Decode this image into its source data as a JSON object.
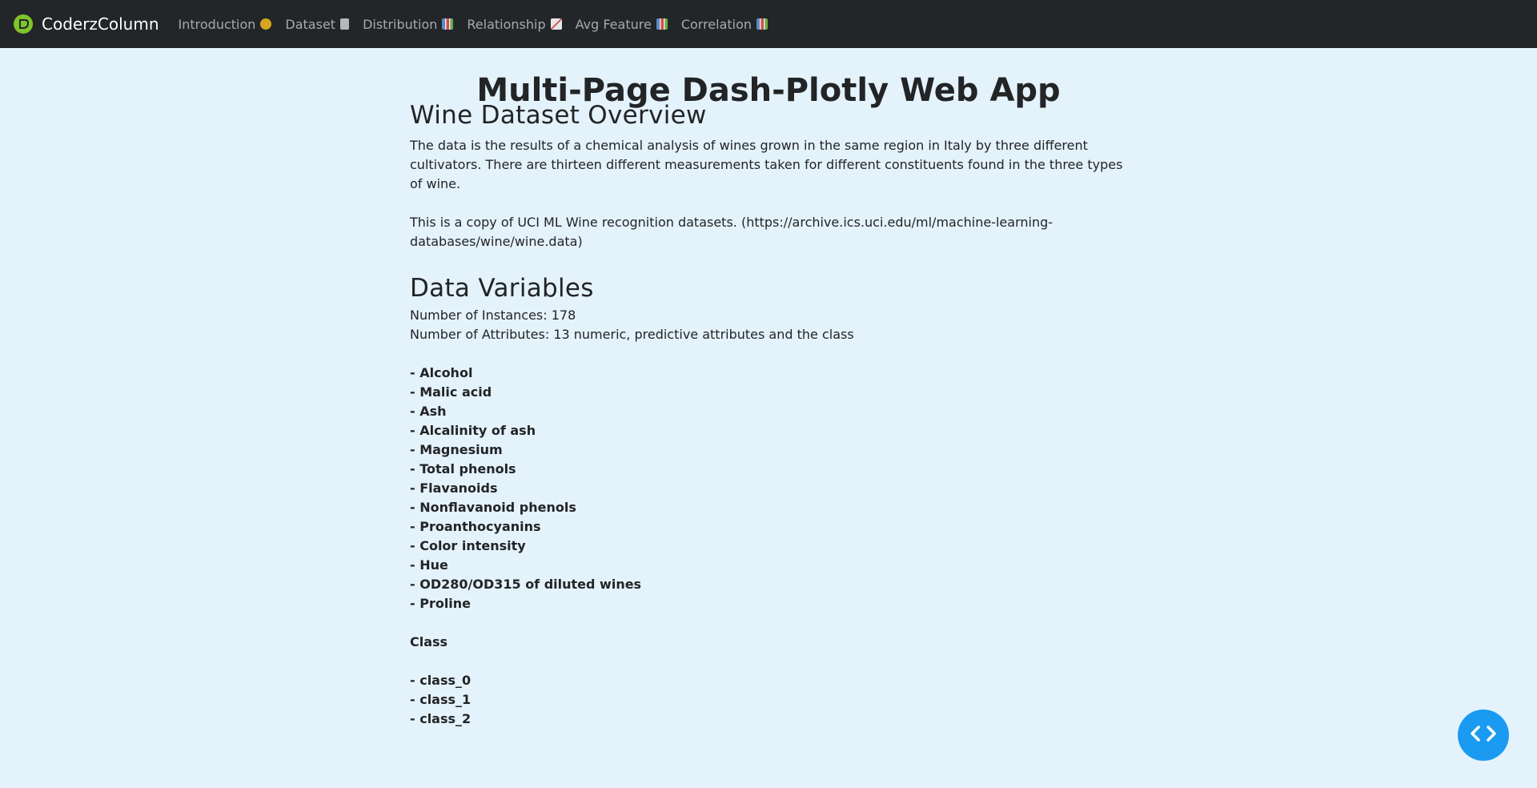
{
  "navbar": {
    "brand": "CoderzColumn",
    "links": [
      {
        "label": "Introduction",
        "icon": "smiley-emoji-icon"
      },
      {
        "label": "Dataset",
        "icon": "clipboard-emoji-icon"
      },
      {
        "label": "Distribution",
        "icon": "bar-chart-emoji-icon"
      },
      {
        "label": "Relationship",
        "icon": "trend-up-emoji-icon"
      },
      {
        "label": "Avg Feature",
        "icon": "bar-chart-emoji-icon"
      },
      {
        "label": "Correlation",
        "icon": "bar-chart-emoji-icon"
      }
    ]
  },
  "app_title": "Multi-Page Dash-Plotly Web App",
  "overview": {
    "heading": "Wine Dataset Overview",
    "paragraph1": "The data is the results of a chemical analysis of wines grown in the same region in Italy by three different cultivators. There are thirteen different measurements taken for different constituents found in the three types of wine.",
    "paragraph2": "This is a copy of UCI ML Wine recognition datasets. (https://archive.ics.uci.edu/ml/machine-learning-databases/wine/wine.data)"
  },
  "variables": {
    "heading": "Data Variables",
    "instances": "Number of Instances: 178",
    "attributes": "Number of Attributes: 13 numeric, predictive attributes and the class",
    "attribute_list": [
      "- Alcohol",
      "- Malic acid",
      "- Ash",
      "- Alcalinity of ash",
      "- Magnesium",
      "- Total phenols",
      "- Flavanoids",
      "- Nonflavanoid phenols",
      "- Proanthocyanins",
      "- Color intensity",
      "- Hue",
      "- OD280/OD315 of diluted wines",
      "- Proline"
    ],
    "class_heading": "Class",
    "class_list": [
      "- class_0",
      "- class_1",
      "- class_2"
    ]
  },
  "colors": {
    "navbar_bg": "#222629",
    "page_bg": "#e4f2fc",
    "fab_bg": "#1a9af0",
    "logo_green": "#7dc52a"
  },
  "fab_icon": "code-brackets-icon"
}
